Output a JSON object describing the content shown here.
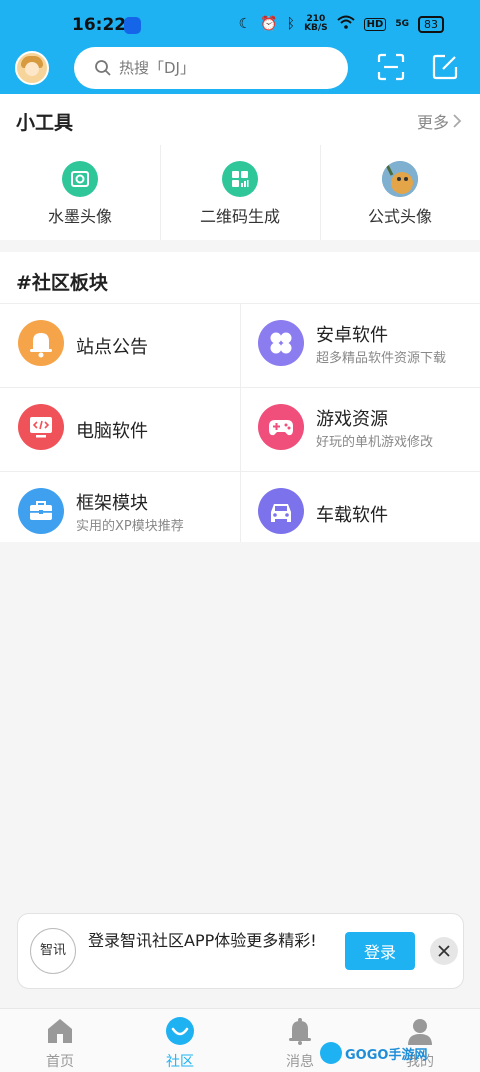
{
  "status_bar": {
    "time": "16:22",
    "net_speed_value": "210",
    "net_speed_unit": "KB/S",
    "hd_label": "HD",
    "signal_label": "5G",
    "battery": "83"
  },
  "header": {
    "search_placeholder": "热搜「DJ」",
    "accent": "#1fb2f2"
  },
  "tools": {
    "title": "小工具",
    "more_label": "更多",
    "items": [
      {
        "label": "水墨头像",
        "icon": "camera-icon",
        "color": "#2fc79a"
      },
      {
        "label": "二维码生成",
        "icon": "qrcode-chart-icon",
        "color": "#2fc79a"
      },
      {
        "label": "公式头像",
        "icon": "formula-avatar-image",
        "color": "#f0a640"
      }
    ]
  },
  "community": {
    "title": "#社区板块",
    "boards": [
      {
        "title": "站点公告",
        "subtitle": "",
        "icon": "bell-icon",
        "color": "#f5a44a"
      },
      {
        "title": "安卓软件",
        "subtitle": "超多精品软件资源下载",
        "icon": "apps-grid-icon",
        "color": "#8b7cf0"
      },
      {
        "title": "电脑软件",
        "subtitle": "",
        "icon": "monitor-code-icon",
        "color": "#f0525a"
      },
      {
        "title": "游戏资源",
        "subtitle": "好玩的单机游戏修改",
        "icon": "gamepad-icon",
        "color": "#ef4f7a"
      },
      {
        "title": "框架模块",
        "subtitle": "实用的XP模块推荐",
        "icon": "toolbox-icon",
        "color": "#3fa0ef"
      },
      {
        "title": "车载软件",
        "subtitle": "",
        "icon": "car-icon",
        "color": "#7c73ec"
      }
    ]
  },
  "banner": {
    "logo_text": "智讯",
    "message": "登录智讯社区APP体验更多精彩!",
    "login_label": "登录"
  },
  "tabbar": {
    "tabs": [
      {
        "label": "首页",
        "icon": "home-icon"
      },
      {
        "label": "社区",
        "icon": "community-icon",
        "active": true
      },
      {
        "label": "消息",
        "icon": "bell-icon"
      },
      {
        "label": "我的",
        "icon": "user-icon"
      }
    ]
  },
  "watermark": {
    "text": "GOGO手游网"
  }
}
